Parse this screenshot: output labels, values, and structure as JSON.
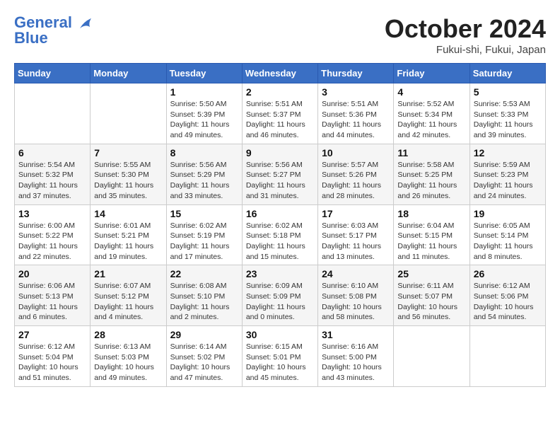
{
  "header": {
    "logo_line1": "General",
    "logo_line2": "Blue",
    "month_year": "October 2024",
    "location": "Fukui-shi, Fukui, Japan"
  },
  "days_of_week": [
    "Sunday",
    "Monday",
    "Tuesday",
    "Wednesday",
    "Thursday",
    "Friday",
    "Saturday"
  ],
  "weeks": [
    [
      {
        "day": "",
        "info": ""
      },
      {
        "day": "",
        "info": ""
      },
      {
        "day": "1",
        "info": "Sunrise: 5:50 AM\nSunset: 5:39 PM\nDaylight: 11 hours and 49 minutes."
      },
      {
        "day": "2",
        "info": "Sunrise: 5:51 AM\nSunset: 5:37 PM\nDaylight: 11 hours and 46 minutes."
      },
      {
        "day": "3",
        "info": "Sunrise: 5:51 AM\nSunset: 5:36 PM\nDaylight: 11 hours and 44 minutes."
      },
      {
        "day": "4",
        "info": "Sunrise: 5:52 AM\nSunset: 5:34 PM\nDaylight: 11 hours and 42 minutes."
      },
      {
        "day": "5",
        "info": "Sunrise: 5:53 AM\nSunset: 5:33 PM\nDaylight: 11 hours and 39 minutes."
      }
    ],
    [
      {
        "day": "6",
        "info": "Sunrise: 5:54 AM\nSunset: 5:32 PM\nDaylight: 11 hours and 37 minutes."
      },
      {
        "day": "7",
        "info": "Sunrise: 5:55 AM\nSunset: 5:30 PM\nDaylight: 11 hours and 35 minutes."
      },
      {
        "day": "8",
        "info": "Sunrise: 5:56 AM\nSunset: 5:29 PM\nDaylight: 11 hours and 33 minutes."
      },
      {
        "day": "9",
        "info": "Sunrise: 5:56 AM\nSunset: 5:27 PM\nDaylight: 11 hours and 31 minutes."
      },
      {
        "day": "10",
        "info": "Sunrise: 5:57 AM\nSunset: 5:26 PM\nDaylight: 11 hours and 28 minutes."
      },
      {
        "day": "11",
        "info": "Sunrise: 5:58 AM\nSunset: 5:25 PM\nDaylight: 11 hours and 26 minutes."
      },
      {
        "day": "12",
        "info": "Sunrise: 5:59 AM\nSunset: 5:23 PM\nDaylight: 11 hours and 24 minutes."
      }
    ],
    [
      {
        "day": "13",
        "info": "Sunrise: 6:00 AM\nSunset: 5:22 PM\nDaylight: 11 hours and 22 minutes."
      },
      {
        "day": "14",
        "info": "Sunrise: 6:01 AM\nSunset: 5:21 PM\nDaylight: 11 hours and 19 minutes."
      },
      {
        "day": "15",
        "info": "Sunrise: 6:02 AM\nSunset: 5:19 PM\nDaylight: 11 hours and 17 minutes."
      },
      {
        "day": "16",
        "info": "Sunrise: 6:02 AM\nSunset: 5:18 PM\nDaylight: 11 hours and 15 minutes."
      },
      {
        "day": "17",
        "info": "Sunrise: 6:03 AM\nSunset: 5:17 PM\nDaylight: 11 hours and 13 minutes."
      },
      {
        "day": "18",
        "info": "Sunrise: 6:04 AM\nSunset: 5:15 PM\nDaylight: 11 hours and 11 minutes."
      },
      {
        "day": "19",
        "info": "Sunrise: 6:05 AM\nSunset: 5:14 PM\nDaylight: 11 hours and 8 minutes."
      }
    ],
    [
      {
        "day": "20",
        "info": "Sunrise: 6:06 AM\nSunset: 5:13 PM\nDaylight: 11 hours and 6 minutes."
      },
      {
        "day": "21",
        "info": "Sunrise: 6:07 AM\nSunset: 5:12 PM\nDaylight: 11 hours and 4 minutes."
      },
      {
        "day": "22",
        "info": "Sunrise: 6:08 AM\nSunset: 5:10 PM\nDaylight: 11 hours and 2 minutes."
      },
      {
        "day": "23",
        "info": "Sunrise: 6:09 AM\nSunset: 5:09 PM\nDaylight: 11 hours and 0 minutes."
      },
      {
        "day": "24",
        "info": "Sunrise: 6:10 AM\nSunset: 5:08 PM\nDaylight: 10 hours and 58 minutes."
      },
      {
        "day": "25",
        "info": "Sunrise: 6:11 AM\nSunset: 5:07 PM\nDaylight: 10 hours and 56 minutes."
      },
      {
        "day": "26",
        "info": "Sunrise: 6:12 AM\nSunset: 5:06 PM\nDaylight: 10 hours and 54 minutes."
      }
    ],
    [
      {
        "day": "27",
        "info": "Sunrise: 6:12 AM\nSunset: 5:04 PM\nDaylight: 10 hours and 51 minutes."
      },
      {
        "day": "28",
        "info": "Sunrise: 6:13 AM\nSunset: 5:03 PM\nDaylight: 10 hours and 49 minutes."
      },
      {
        "day": "29",
        "info": "Sunrise: 6:14 AM\nSunset: 5:02 PM\nDaylight: 10 hours and 47 minutes."
      },
      {
        "day": "30",
        "info": "Sunrise: 6:15 AM\nSunset: 5:01 PM\nDaylight: 10 hours and 45 minutes."
      },
      {
        "day": "31",
        "info": "Sunrise: 6:16 AM\nSunset: 5:00 PM\nDaylight: 10 hours and 43 minutes."
      },
      {
        "day": "",
        "info": ""
      },
      {
        "day": "",
        "info": ""
      }
    ]
  ]
}
